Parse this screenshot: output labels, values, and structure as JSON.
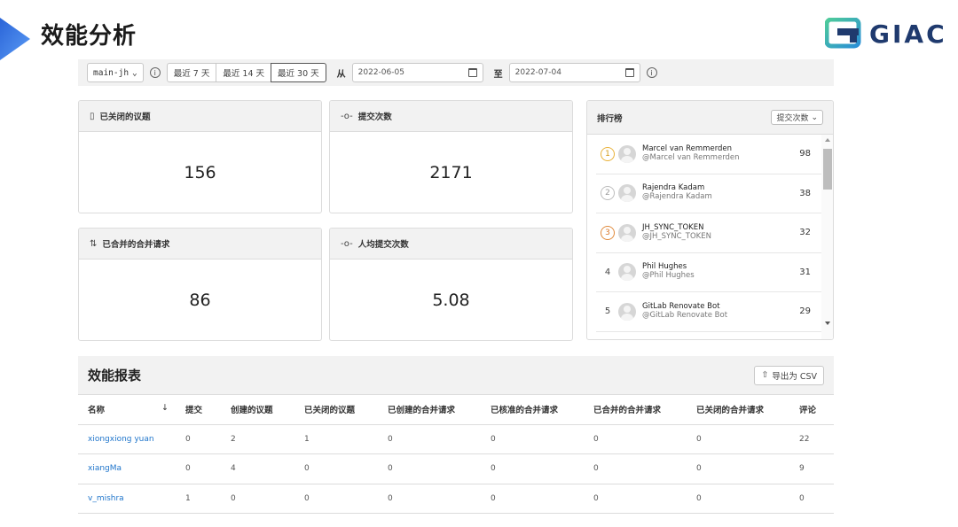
{
  "slide": {
    "title": "效能分析",
    "logo_text": "GIAC"
  },
  "filters": {
    "branch": "main-jh",
    "ranges": [
      {
        "label": "最近 7 天",
        "active": false
      },
      {
        "label": "最近 14 天",
        "active": false
      },
      {
        "label": "最近 30 天",
        "active": true
      }
    ],
    "from_label": "从",
    "from_date": "2022-06-05",
    "to_label": "至",
    "to_date": "2022-07-04"
  },
  "stats": {
    "closed_issues": {
      "label": "已关闭的议题",
      "value": "156"
    },
    "commits": {
      "label": "提交次数",
      "value": "2171"
    },
    "merged_mrs": {
      "label": "已合并的合并请求",
      "value": "86"
    },
    "avg_commits": {
      "label": "人均提交次数",
      "value": "5.08"
    }
  },
  "leaderboard": {
    "title": "排行榜",
    "sort_label": "提交次数",
    "rows": [
      {
        "rank": "1",
        "name": "Marcel van Remmerden",
        "handle": "@Marcel van Remmerden",
        "count": "98"
      },
      {
        "rank": "2",
        "name": "Rajendra Kadam",
        "handle": "@Rajendra Kadam",
        "count": "38"
      },
      {
        "rank": "3",
        "name": "JH_SYNC_TOKEN",
        "handle": "@JH_SYNC_TOKEN",
        "count": "32"
      },
      {
        "rank": "4",
        "name": "Phil Hughes",
        "handle": "@Phil Hughes",
        "count": "31"
      },
      {
        "rank": "5",
        "name": "GitLab Renovate Bot",
        "handle": "@GitLab Renovate Bot",
        "count": "29"
      }
    ]
  },
  "report": {
    "title": "效能报表",
    "export_label": "导出为 CSV",
    "sort_indicator": "↓",
    "columns": [
      "名称",
      "提交",
      "创建的议题",
      "已关闭的议题",
      "已创建的合并请求",
      "已核准的合并请求",
      "已合并的合并请求",
      "已关闭的合并请求",
      "评论"
    ],
    "rows": [
      [
        "xiongxiong yuan",
        "0",
        "2",
        "1",
        "0",
        "0",
        "0",
        "0",
        "22"
      ],
      [
        "xiangMa",
        "0",
        "4",
        "0",
        "0",
        "0",
        "0",
        "0",
        "9"
      ],
      [
        "v_mishra",
        "1",
        "0",
        "0",
        "0",
        "0",
        "0",
        "0",
        "0"
      ]
    ]
  },
  "colors": {
    "accent_blue": "#1f75cb",
    "header_gray": "#f2f2f2",
    "gold": "#e9b23a",
    "bronze": "#e08a3c"
  }
}
